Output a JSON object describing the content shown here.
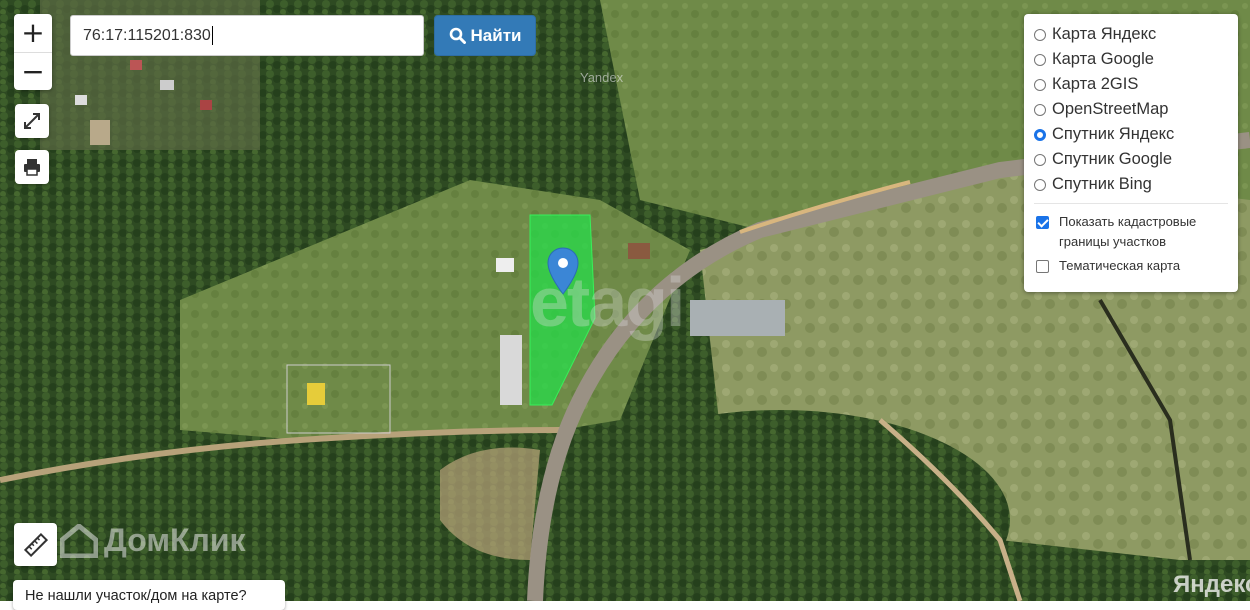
{
  "search": {
    "value": "76:17:115201:830",
    "button_label": "Найти"
  },
  "zoom": {
    "in_label": "+",
    "out_label": "−"
  },
  "layers": {
    "options": [
      {
        "label": "Карта Яндекс",
        "checked": false
      },
      {
        "label": "Карта Google",
        "checked": false
      },
      {
        "label": "Карта 2GIS",
        "checked": false
      },
      {
        "label": "OpenStreetMap",
        "checked": false
      },
      {
        "label": "Спутник Яндекс",
        "checked": true
      },
      {
        "label": "Спутник Google",
        "checked": false
      },
      {
        "label": "Спутник Bing",
        "checked": false
      }
    ],
    "show_cadastral": {
      "label": "Показать кадастровые границы участков",
      "checked": true
    },
    "thematic": {
      "label": "Тематическая карта",
      "checked": false
    }
  },
  "not_found_label": "Не нашли участок/дом на карте?",
  "watermarks": {
    "etagi": "etagi",
    "domclick": "ДомКлик",
    "yandex_small": "Yandex",
    "yandex_big": "Яндекс"
  },
  "colors": {
    "accent": "#337ab7",
    "parcel": "#22e04a",
    "marker": "#3b86d6"
  },
  "icons": {
    "fullscreen": "expand-arrows-icon",
    "print": "printer-icon",
    "ruler": "ruler-icon",
    "search": "magnifier-icon",
    "marker": "map-pin-icon"
  }
}
